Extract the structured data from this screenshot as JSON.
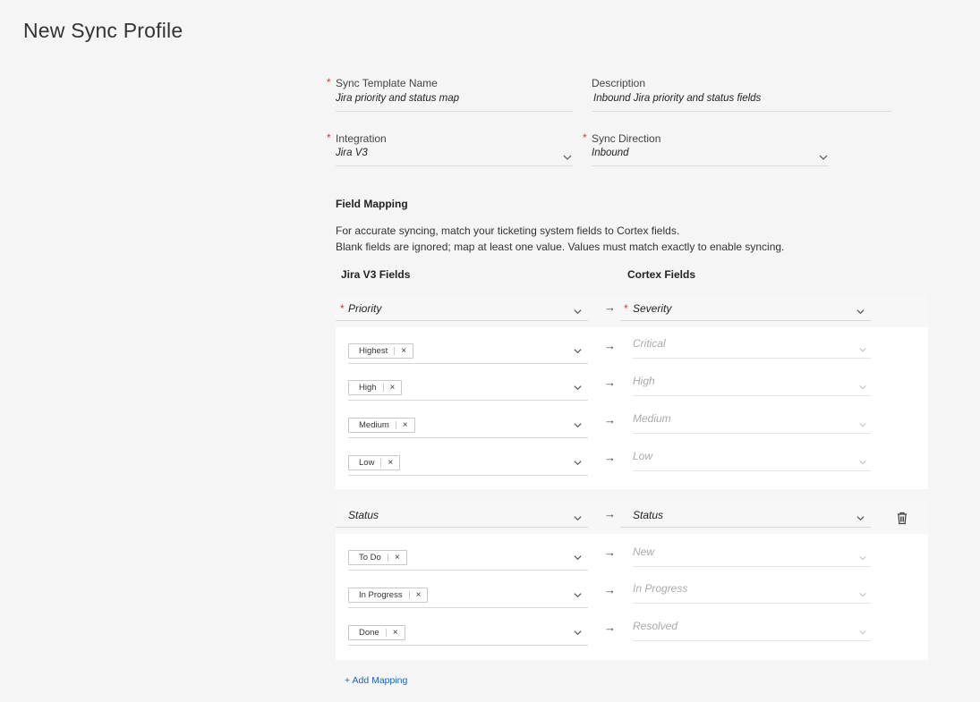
{
  "page": {
    "title": "New Sync Profile"
  },
  "form": {
    "template_name": {
      "label": "Sync Template Name",
      "value": "Jira priority and status map",
      "required": true
    },
    "description": {
      "label": "Description",
      "value": "Inbound Jira priority and status fields"
    },
    "integration": {
      "label": "Integration",
      "value": "Jira V3",
      "required": true
    },
    "sync_direction": {
      "label": "Sync Direction",
      "value": "Inbound",
      "required": true
    }
  },
  "field_mapping": {
    "title": "Field Mapping",
    "help_line1": "For accurate syncing, match your ticketing system fields to Cortex fields.",
    "help_line2": "Blank fields are ignored; map at least one value. Values must match exactly to enable syncing.",
    "left_header": "Jira V3 Fields",
    "right_header": "Cortex Fields",
    "arrow": "→",
    "chip_remove": "×",
    "groups": [
      {
        "source": "Priority",
        "target": "Severity",
        "required": true,
        "rows": [
          {
            "source_value": "Highest",
            "target_value": "Critical"
          },
          {
            "source_value": "High",
            "target_value": "High"
          },
          {
            "source_value": "Medium",
            "target_value": "Medium"
          },
          {
            "source_value": "Low",
            "target_value": "Low"
          }
        ]
      },
      {
        "source": "Status",
        "target": "Status",
        "required": false,
        "delete_icon": "trash-icon",
        "rows": [
          {
            "source_value": "To Do",
            "target_value": "New"
          },
          {
            "source_value": "In Progress",
            "target_value": "In Progress"
          },
          {
            "source_value": "Done",
            "target_value": "Resolved"
          }
        ]
      }
    ],
    "add_mapping_label": "+ Add Mapping"
  },
  "colors": {
    "required": "#d33333",
    "link": "#1d62b8",
    "background": "#f5f5f5"
  }
}
